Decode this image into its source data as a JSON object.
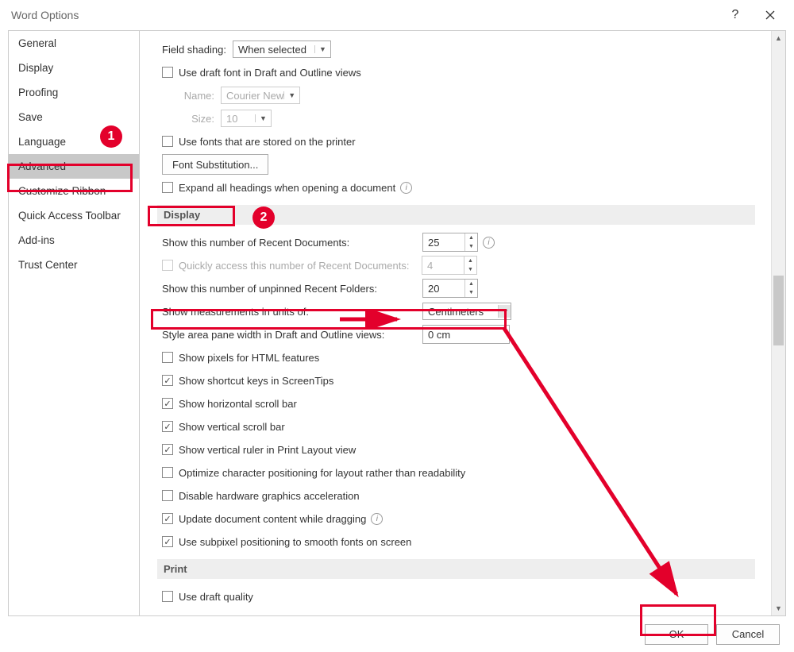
{
  "window": {
    "title": "Word Options"
  },
  "sidebar": {
    "items": [
      "General",
      "Display",
      "Proofing",
      "Save",
      "Language",
      "Advanced",
      "Customize Ribbon",
      "Quick Access Toolbar",
      "Add-ins",
      "Trust Center"
    ],
    "active": "Advanced"
  },
  "top": {
    "field_shading_label": "Field shading:",
    "field_shading_value": "When selected",
    "draft_font": "Use draft font in Draft and Outline views",
    "name_label": "Name:",
    "name_value": "Courier New",
    "size_label": "Size:",
    "size_value": "10",
    "use_printer_fonts": "Use fonts that are stored on the printer",
    "font_sub_btn": "Font Substitution...",
    "expand_headings": "Expand all headings when opening a document"
  },
  "display": {
    "heading": "Display",
    "recent_docs_label": "Show this number of Recent Documents:",
    "recent_docs_value": "25",
    "quick_access_label": "Quickly access this number of Recent Documents:",
    "quick_access_value": "4",
    "recent_folders_label": "Show this number of unpinned Recent Folders:",
    "recent_folders_value": "20",
    "units_label": "Show measurements in units of:",
    "units_value": "Centimeters",
    "style_pane_label": "Style area pane width in Draft and Outline views:",
    "style_pane_value": "0 cm",
    "pixels_html": "Show pixels for HTML features",
    "shortcut_keys": "Show shortcut keys in ScreenTips",
    "hscroll": "Show horizontal scroll bar",
    "vscroll": "Show vertical scroll bar",
    "vruler": "Show vertical ruler in Print Layout view",
    "optimize_pos": "Optimize character positioning for layout rather than readability",
    "disable_hw": "Disable hardware graphics acceleration",
    "update_drag": "Update document content while dragging",
    "subpixel": "Use subpixel positioning to smooth fonts on screen"
  },
  "print": {
    "heading": "Print",
    "draft_quality": "Use draft quality"
  },
  "footer": {
    "ok": "OK",
    "cancel": "Cancel"
  },
  "anno": {
    "one": "1",
    "two": "2"
  }
}
